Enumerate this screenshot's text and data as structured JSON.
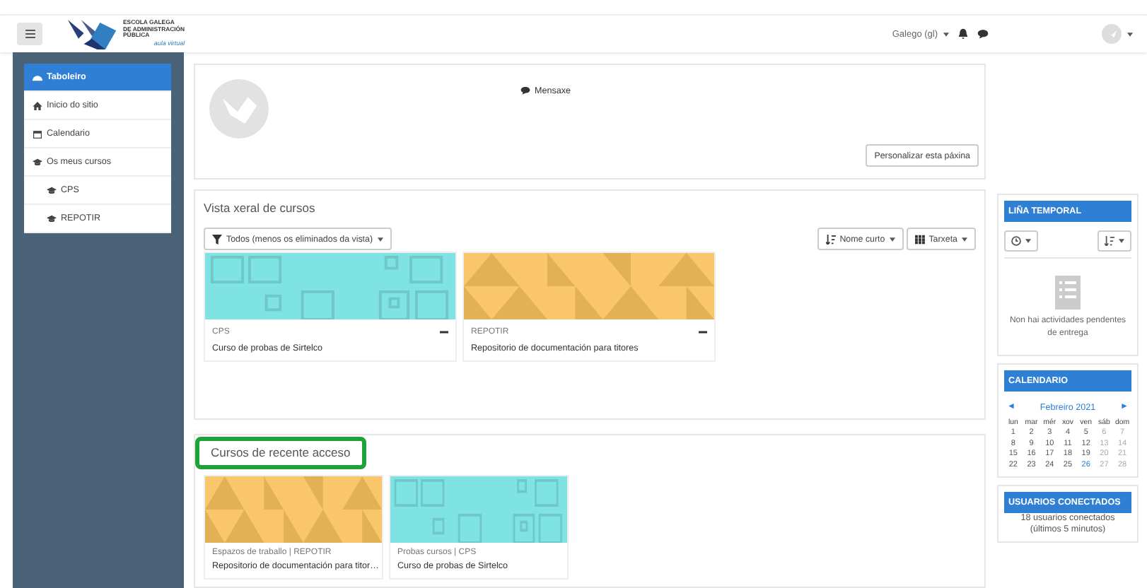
{
  "header": {
    "logo": {
      "lines": [
        "ESCOLA GALEGA",
        "DE ADMINISTRACIÓN",
        "PÚBLICA"
      ],
      "tagline": "aula virtual"
    },
    "language": "Galego (gl)"
  },
  "sidebar": {
    "items": [
      {
        "label": "Taboleiro",
        "kind": "dashboard",
        "selected": true
      },
      {
        "label": "Inicio do sitio",
        "kind": "home",
        "selected": false
      },
      {
        "label": "Calendario",
        "kind": "calendar",
        "selected": false
      },
      {
        "label": "Os meus cursos",
        "kind": "courses",
        "selected": false,
        "children": [
          {
            "label": "CPS",
            "kind": "courses",
            "selected": false
          },
          {
            "label": "REPOTIR",
            "kind": "courses",
            "selected": false
          }
        ]
      }
    ]
  },
  "profile": {
    "message_link": "Mensaxe",
    "customize_button": "Personalizar esta páxina"
  },
  "course_overview": {
    "title": "Vista xeral de cursos",
    "filter": "Todos (menos os eliminados da vista)",
    "sort": "Nome curto",
    "view": "Tarxeta",
    "courses": [
      {
        "category": "CPS",
        "name": "Curso de probas de Sirtelco",
        "color": "#7fe3e3",
        "kind": "squares"
      },
      {
        "category": "REPOTIR",
        "name": "Repositorio de documentación para titores",
        "color": "#f9c66b",
        "kind": "triangles"
      }
    ]
  },
  "recent": {
    "title": "Cursos de recente acceso",
    "highlighted": true,
    "courses": [
      {
        "category": "Espazos de traballo | REPOTIR",
        "name": "Repositorio de documentación para titor…",
        "color": "#f9c66b",
        "kind": "triangles"
      },
      {
        "category": "Probas cursos | CPS",
        "name": "Curso de probas de Sirtelco",
        "color": "#7fe3e3",
        "kind": "squares"
      }
    ]
  },
  "timeline": {
    "title": "LIÑA TEMPORAL",
    "empty_text": "Non hai actividades pendentes de entrega"
  },
  "calendar": {
    "title": "CALENDARIO",
    "prev": "◄",
    "month": "Febreiro 2021",
    "next": "►",
    "weekdays": [
      "lun",
      "mar",
      "mér",
      "xov",
      "ven",
      "sáb",
      "dom"
    ],
    "weeks": [
      [
        {
          "d": "1",
          "today": false
        },
        {
          "d": "2",
          "today": false
        },
        {
          "d": "3",
          "today": false
        },
        {
          "d": "4",
          "today": false
        },
        {
          "d": "5",
          "today": false
        },
        {
          "d": "6",
          "today": false
        },
        {
          "d": "7",
          "today": false
        }
      ],
      [
        {
          "d": "8",
          "today": false
        },
        {
          "d": "9",
          "today": false
        },
        {
          "d": "10",
          "today": false
        },
        {
          "d": "11",
          "today": false
        },
        {
          "d": "12",
          "today": false
        },
        {
          "d": "13",
          "today": false
        },
        {
          "d": "14",
          "today": false
        }
      ],
      [
        {
          "d": "15",
          "today": false
        },
        {
          "d": "16",
          "today": false
        },
        {
          "d": "17",
          "today": false
        },
        {
          "d": "18",
          "today": false
        },
        {
          "d": "19",
          "today": false
        },
        {
          "d": "20",
          "today": false
        },
        {
          "d": "21",
          "today": false
        }
      ],
      [
        {
          "d": "22",
          "today": false
        },
        {
          "d": "23",
          "today": false
        },
        {
          "d": "24",
          "today": false
        },
        {
          "d": "25",
          "today": false
        },
        {
          "d": "26",
          "today": true
        },
        {
          "d": "27",
          "today": false
        },
        {
          "d": "28",
          "today": false
        }
      ]
    ]
  },
  "online_users": {
    "title": "USUARIOS CONECTADOS",
    "count_text": "18 usuarios conectados",
    "period": "(últimos 5 minutos)"
  }
}
